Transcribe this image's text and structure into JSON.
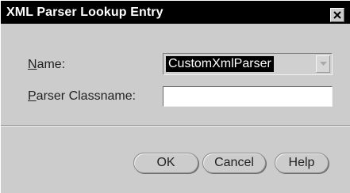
{
  "window": {
    "title": "XML Parser Lookup Entry"
  },
  "form": {
    "name_label_mnemonic": "N",
    "name_label_rest": "ame:",
    "name_value": "CustomXmlParser",
    "classname_label_mnemonic": "P",
    "classname_label_rest": "arser Classname:",
    "classname_value": ""
  },
  "buttons": {
    "ok": "OK",
    "cancel": "Cancel",
    "help": "Help"
  },
  "icons": {
    "close": "close-icon",
    "dropdown": "chevron-down-icon"
  }
}
